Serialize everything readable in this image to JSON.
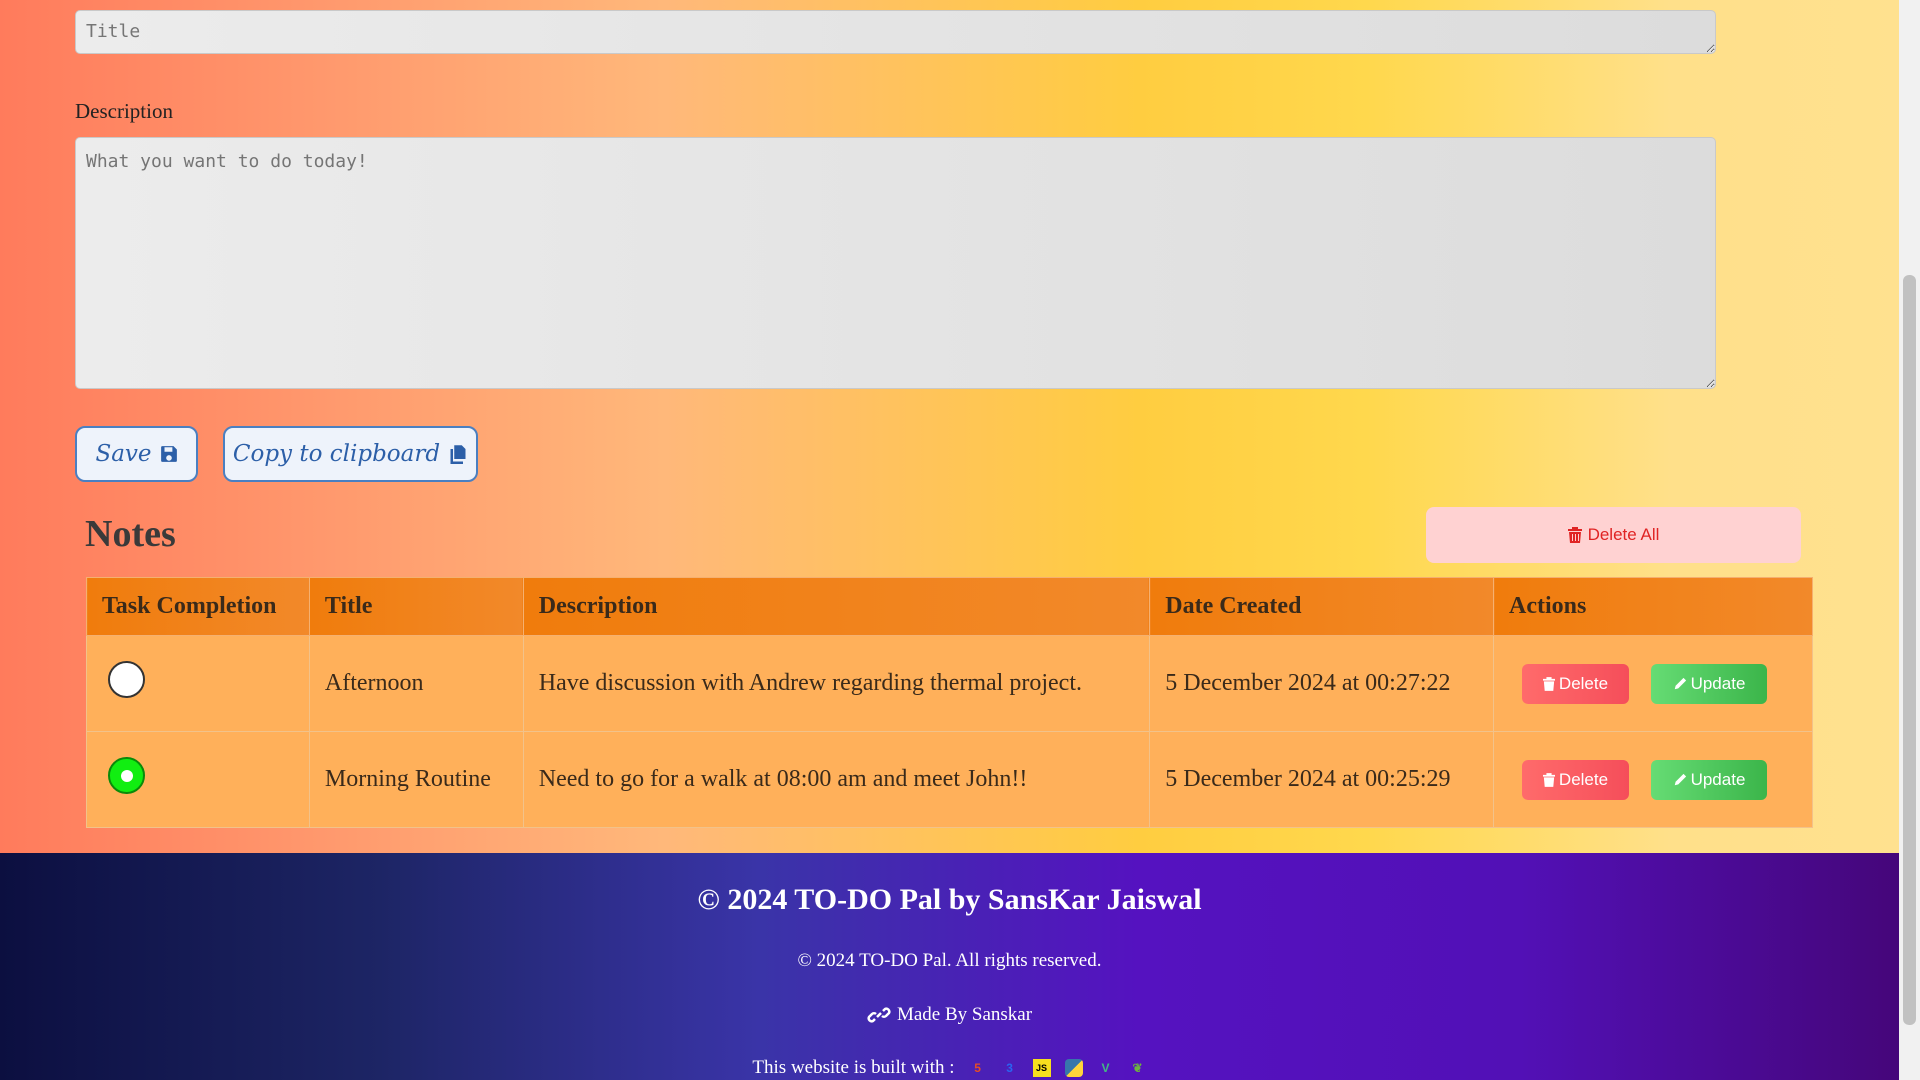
{
  "form": {
    "title_placeholder": "Title",
    "description_label": "Description",
    "description_placeholder": "What you want to do today!",
    "save_label": "Save",
    "copy_label": "Copy to clipboard"
  },
  "notes": {
    "heading": "Notes",
    "delete_all_label": "Delete All",
    "columns": [
      "Task Completion",
      "Title",
      "Description",
      "Date Created",
      "Actions"
    ],
    "rows": [
      {
        "completed": false,
        "title": "Afternoon",
        "description": "Have discussion with Andrew regarding thermal project.",
        "date": "5 December 2024 at 00:27:22",
        "delete_label": "Delete",
        "update_label": "Update"
      },
      {
        "completed": true,
        "title": "Morning Routine",
        "description": "Need to go for a walk at 08:00 am and meet John!!",
        "date": "5 December 2024 at 00:25:29",
        "delete_label": "Delete",
        "update_label": "Update"
      }
    ]
  },
  "footer": {
    "title": "© 2024 TO-DO Pal by SansKar Jaiswal",
    "rights": "© 2024 TO-DO Pal. All rights reserved.",
    "made_by": "Made By Sanskar",
    "built_with": "This website is built with :",
    "tech_icons": [
      "html5-icon",
      "css3-icon",
      "javascript-icon",
      "python-icon",
      "vue-icon",
      "leaf-icon"
    ]
  },
  "colors": {
    "delete": "#f54e5a",
    "update": "#3bb54a",
    "table_header": "#f07c0c",
    "table_row": "#ffb05a",
    "accent_blue": "#2c5fa8"
  }
}
